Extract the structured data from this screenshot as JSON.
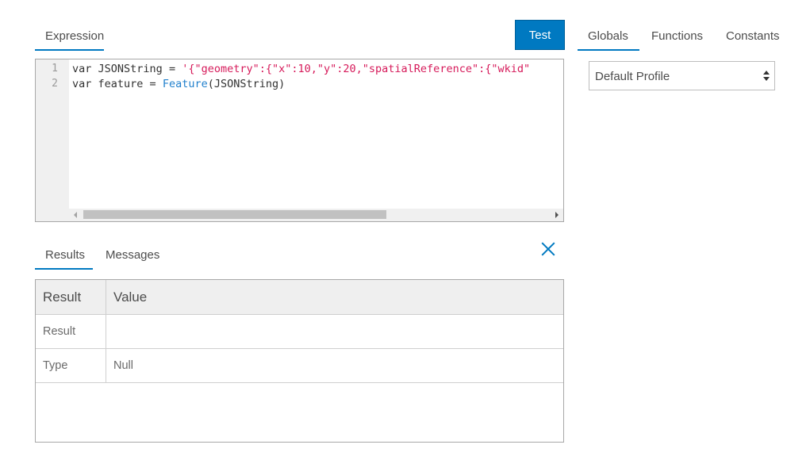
{
  "editor_tabs": {
    "expression": "Expression"
  },
  "toolbar": {
    "test_label": "Test"
  },
  "side_tabs": {
    "globals": "Globals",
    "functions": "Functions",
    "constants": "Constants"
  },
  "profile_select": {
    "value": "Default Profile"
  },
  "code": {
    "line_numbers": [
      "1",
      "2"
    ],
    "line1": {
      "kw": "var",
      "ident": " JSONString ",
      "op": "=",
      "str": " '{\"geometry\":{\"x\":10,\"y\":20,\"spatialReference\":{\"wkid\""
    },
    "line2": {
      "kw": "var",
      "ident": " feature ",
      "op": "=",
      "fn": " Feature",
      "rest": "(JSONString)"
    }
  },
  "results_tabs": {
    "results": "Results",
    "messages": "Messages"
  },
  "results_table": {
    "headers": [
      "Result",
      "Value"
    ],
    "rows": [
      {
        "label": "Result",
        "value": ""
      },
      {
        "label": "Type",
        "value": "Null"
      }
    ]
  },
  "colors": {
    "accent": "#0079c1",
    "string": "#d61a5a",
    "function": "#1f7fcc"
  }
}
